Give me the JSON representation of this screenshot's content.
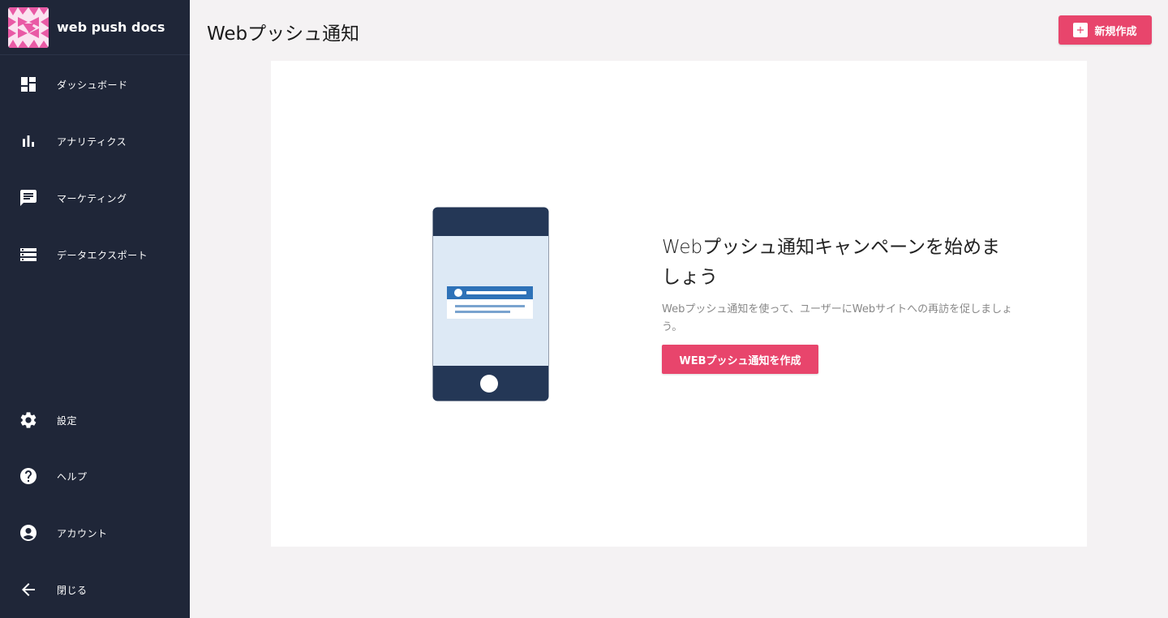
{
  "brand": {
    "name": "web push docs",
    "logo_icon": "pattern-logo",
    "logo_color": "#e95aa5"
  },
  "nav": {
    "top": [
      {
        "label": "ダッシュボード",
        "icon": "dashboard-icon"
      },
      {
        "label": "アナリティクス",
        "icon": "bar-chart-icon"
      },
      {
        "label": "マーケティング",
        "icon": "message-icon"
      },
      {
        "label": "データエクスポート",
        "icon": "storage-icon"
      }
    ],
    "bottom": [
      {
        "label": "設定",
        "icon": "gear-icon"
      },
      {
        "label": "ヘルプ",
        "icon": "help-icon"
      },
      {
        "label": "アカウント",
        "icon": "account-icon"
      },
      {
        "label": "閉じる",
        "icon": "arrow-left-icon"
      }
    ]
  },
  "header": {
    "title": "Webプッシュ通知",
    "new_button_label": "新規作成"
  },
  "empty_state": {
    "title": "Webプッシュ通知キャンペーンを始めましょう",
    "description": "Webプッシュ通知を使って、ユーザーにWebサイトへの再訪を促しましょう。",
    "cta_label": "WEBプッシュ通知を作成"
  },
  "colors": {
    "sidebar_bg": "#1f2638",
    "accent": "#e8456c",
    "page_bg": "#f4f2f3",
    "phone_dark": "#243756",
    "phone_screen": "#dde9f5",
    "notification_blue": "#2e72b8"
  }
}
